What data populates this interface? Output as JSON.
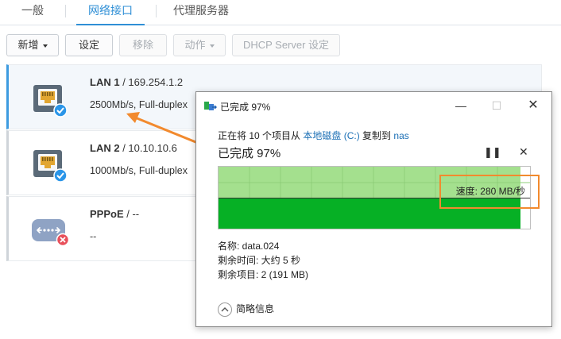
{
  "tabs": [
    {
      "label": "一般",
      "active": false
    },
    {
      "label": "网络接口",
      "active": true
    },
    {
      "label": "代理服务器",
      "active": false
    }
  ],
  "toolbar": {
    "create": "新增",
    "settings": "设定",
    "remove": "移除",
    "action": "动作",
    "dhcp": "DHCP Server 设定"
  },
  "interfaces": [
    {
      "name": "LAN 1",
      "address": "/ 169.254.1.2",
      "status": "2500Mb/s, Full-duplex",
      "selected": true,
      "connected": true
    },
    {
      "name": "LAN 2",
      "address": "/ 10.10.10.6",
      "status": "1000Mb/s, Full-duplex",
      "selected": false,
      "connected": true
    },
    {
      "name": "PPPoE",
      "address": "/ --",
      "status": "--",
      "selected": false,
      "connected": false
    }
  ],
  "dialog": {
    "title": "已完成 97%",
    "copy_prefix": "正在将 10 个项目从",
    "source": "本地磁盘 (C:)",
    "copy_mid": "复制到",
    "destination": "nas",
    "progress_text": "已完成 97%",
    "progress": 0.97,
    "speed": "速度: 280 MB/秒",
    "name_line": "名称: data.024",
    "time_line": "剩余时间: 大约 5 秒",
    "items_line": "剩余项目: 2 (191 MB)",
    "details": "简略信息"
  },
  "colors": {
    "accent": "#2f8fd6",
    "graph_fill": "#06b025",
    "graph_light": "#a4e08e",
    "annotation": "#f28a2e"
  }
}
